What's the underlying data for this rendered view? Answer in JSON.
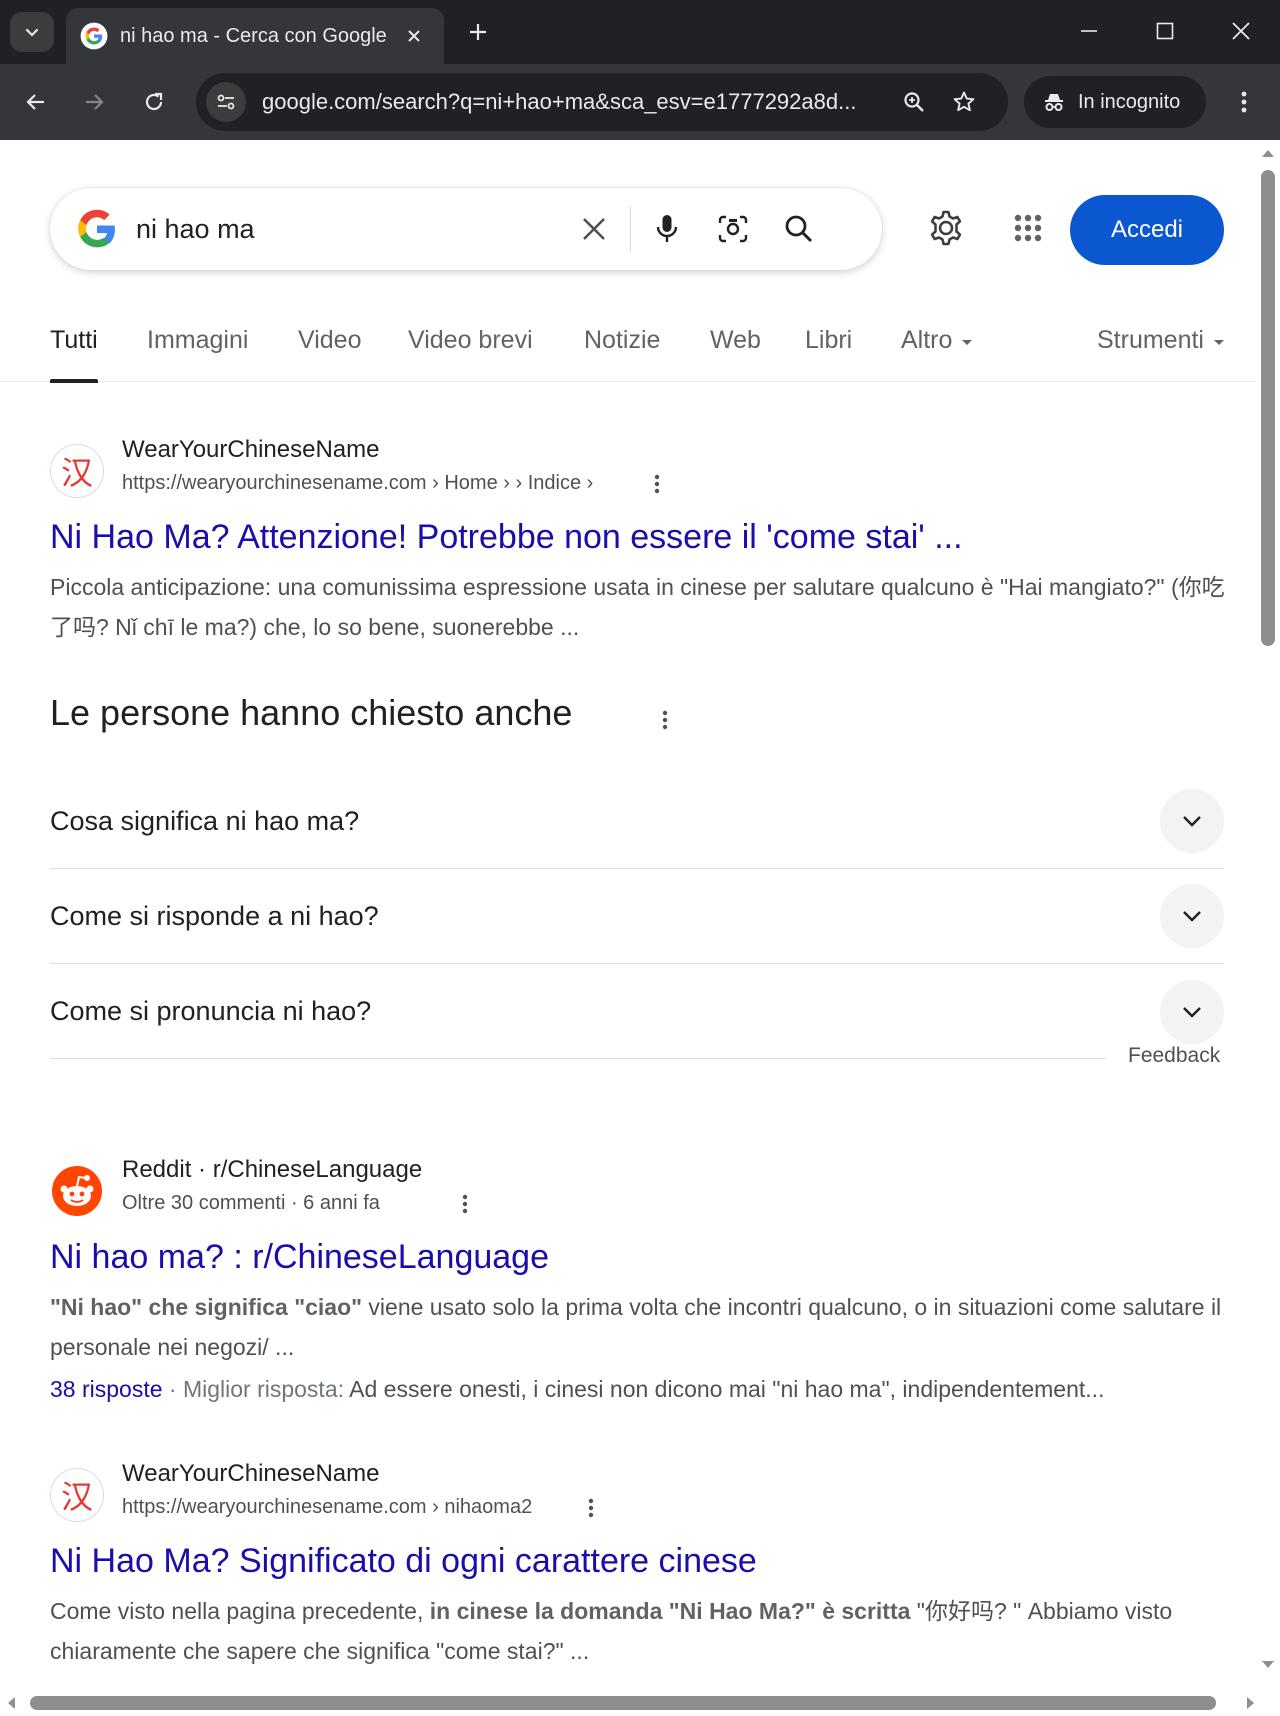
{
  "browser": {
    "tab_title": "ni hao ma - Cerca con Google",
    "url": "google.com/search?q=ni+hao+ma&sca_esv=e1777292a8d...",
    "incognito_label": "In incognito",
    "window_controls": [
      "minimize-icon",
      "maximize-icon",
      "close-icon"
    ]
  },
  "search": {
    "query": "ni hao ma",
    "signin_label": "Accedi",
    "colors": {
      "signin_bg": "#0b57d0",
      "link": "#1a0dab"
    }
  },
  "tabs": [
    {
      "label": "Tutti",
      "active": true
    },
    {
      "label": "Immagini"
    },
    {
      "label": "Video"
    },
    {
      "label": "Video brevi"
    },
    {
      "label": "Notizie"
    },
    {
      "label": "Web"
    },
    {
      "label": "Libri"
    },
    {
      "label": "Altro"
    },
    {
      "label": "Strumenti"
    }
  ],
  "results": [
    {
      "site": "WearYourChineseName",
      "url": "https://wearyourchinesename.com › Home › › Indice ›",
      "title": "Ni Hao Ma? Attenzione! Potrebbe non essere il 'come stai' ...",
      "snippet": "Piccola anticipazione: una comunissima espressione usata in cinese per salutare qualcuno è \"Hai mangiato?\" (你吃了吗? Nǐ chī le ma?) che, lo so bene, suonerebbe ..."
    },
    {
      "site": "Reddit · r/ChineseLanguage",
      "url": "Oltre 30 commenti · 6 anni fa",
      "title": "Ni hao ma? : r/ChineseLanguage",
      "snippet_bold": "\"Ni hao\" che significa \"ciao\"",
      "snippet_rest": " viene usato solo la prima volta che incontri qualcuno, o in situazioni come salutare il personale nei negozi/ ...",
      "answers_link": "38 risposte",
      "answers_sep": " · Miglior risposta: ",
      "answers_text": "Ad essere onesti, i cinesi non dicono mai \"ni hao ma\", indipendentement..."
    },
    {
      "site": "WearYourChineseName",
      "url": "https://wearyourchinesename.com › nihaoma2",
      "title": "Ni Hao Ma? Significato di ogni carattere cinese",
      "snippet_pre": "Come visto nella pagina precedente, ",
      "snippet_bold": "in cinese la domanda \"Ni Hao Ma?\" è scritta",
      "snippet_post": " \"你好吗? \" Abbiamo visto chiaramente che sapere che significa \"come stai?\" ..."
    }
  ],
  "paa": {
    "title": "Le persone hanno chiesto anche",
    "questions": [
      "Cosa significa ni hao ma?",
      "Come si risponde a ni hao?",
      "Come si pronuncia ni hao?"
    ],
    "feedback": "Feedback"
  },
  "favicons": {
    "wycn_char": "汉"
  }
}
